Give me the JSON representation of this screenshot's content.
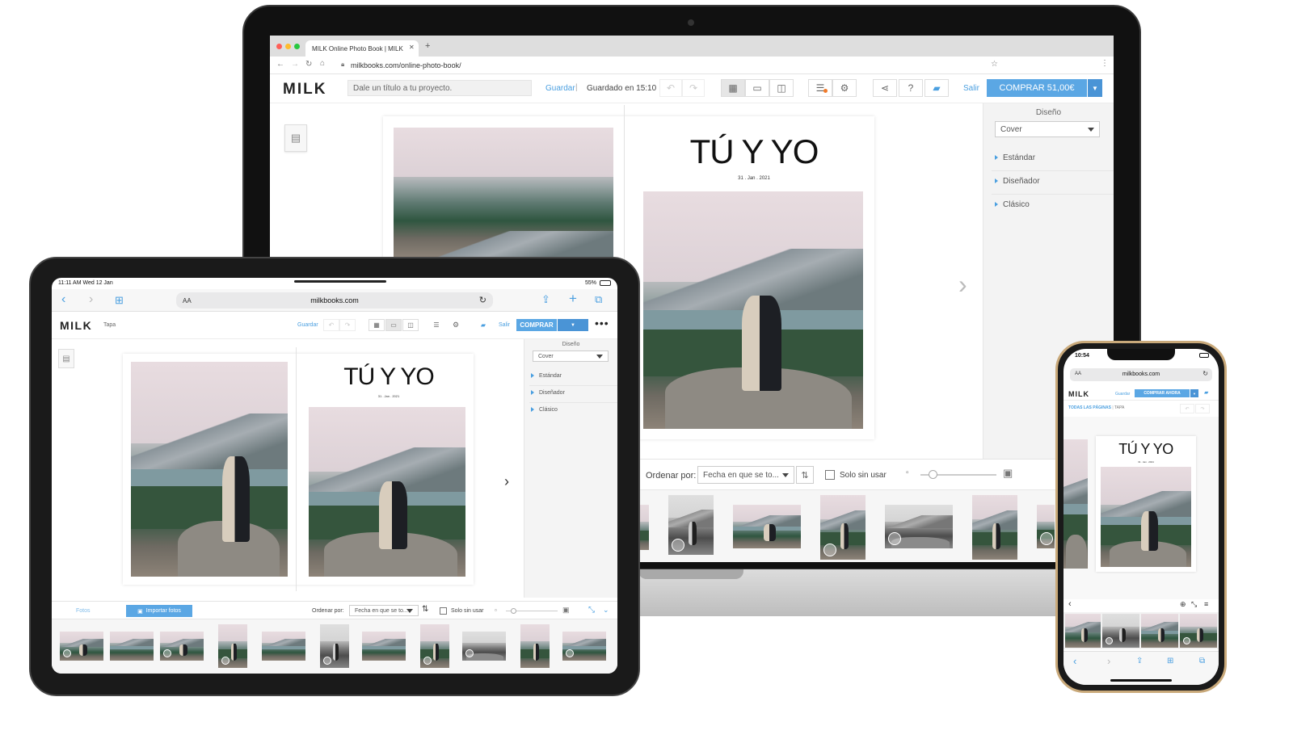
{
  "laptop": {
    "browser": {
      "tab_title": "MILK Online Photo Book | MILK",
      "url": "milkbooks.com/online-photo-book/"
    },
    "toolbar": {
      "logo": "MILK",
      "title_placeholder": "Dale un título a tu proyecto.",
      "save_label": "Guardar",
      "saved_status": "Guardado en 15:10",
      "exit_label": "Salir",
      "buy_label": "COMPRAR 51,00€"
    },
    "panel": {
      "heading": "Diseño",
      "select_value": "Cover",
      "items": [
        "Estándar",
        "Diseñador",
        "Clásico"
      ]
    },
    "cover": {
      "title": "TÚ Y YO",
      "date": "31 . Jan . 2021"
    },
    "filmstrip": {
      "order_label": "Ordenar por:",
      "order_value": "Fecha en que se to...",
      "unused_label": "Solo sin usar"
    }
  },
  "tablet": {
    "status": {
      "time": "11:11 AM  Wed 12 Jan",
      "battery": "55%"
    },
    "address": {
      "text_size": "AA",
      "url": "milkbooks.com"
    },
    "toolbar": {
      "logo": "MILK",
      "page": "Tapa",
      "save_label": "Guardar",
      "exit_label": "Salir",
      "buy_label": "COMPRAR"
    },
    "panel": {
      "heading": "Diseño",
      "select_value": "Cover",
      "items": [
        "Estándar",
        "Diseñador",
        "Clásico"
      ]
    },
    "cover": {
      "title": "TÚ Y YO",
      "date": "31 . Jan . 2021"
    },
    "filmstrip": {
      "tab_photos": "Fotos",
      "import_label": "Importar fotos",
      "order_label": "Ordenar por:",
      "order_value": "Fecha en que se to...",
      "unused_label": "Solo sin usar"
    }
  },
  "phone": {
    "status": {
      "time": "10:54"
    },
    "address": {
      "text_size": "AA",
      "url": "milkbooks.com"
    },
    "toolbar": {
      "logo": "MILK",
      "save_label": "Guardar",
      "buy_label": "COMPRAR AHORA"
    },
    "breadcrumb": {
      "all_pages": "TODAS LAS PÁGINAS",
      "cover": "TAPA"
    },
    "cover": {
      "title": "TÚ Y YO",
      "date": "31 . Jan . 2021"
    }
  },
  "colors": {
    "accent": "#4a9fe0",
    "buy_button": "#5ba7e4",
    "dark_frame": "#111111"
  }
}
